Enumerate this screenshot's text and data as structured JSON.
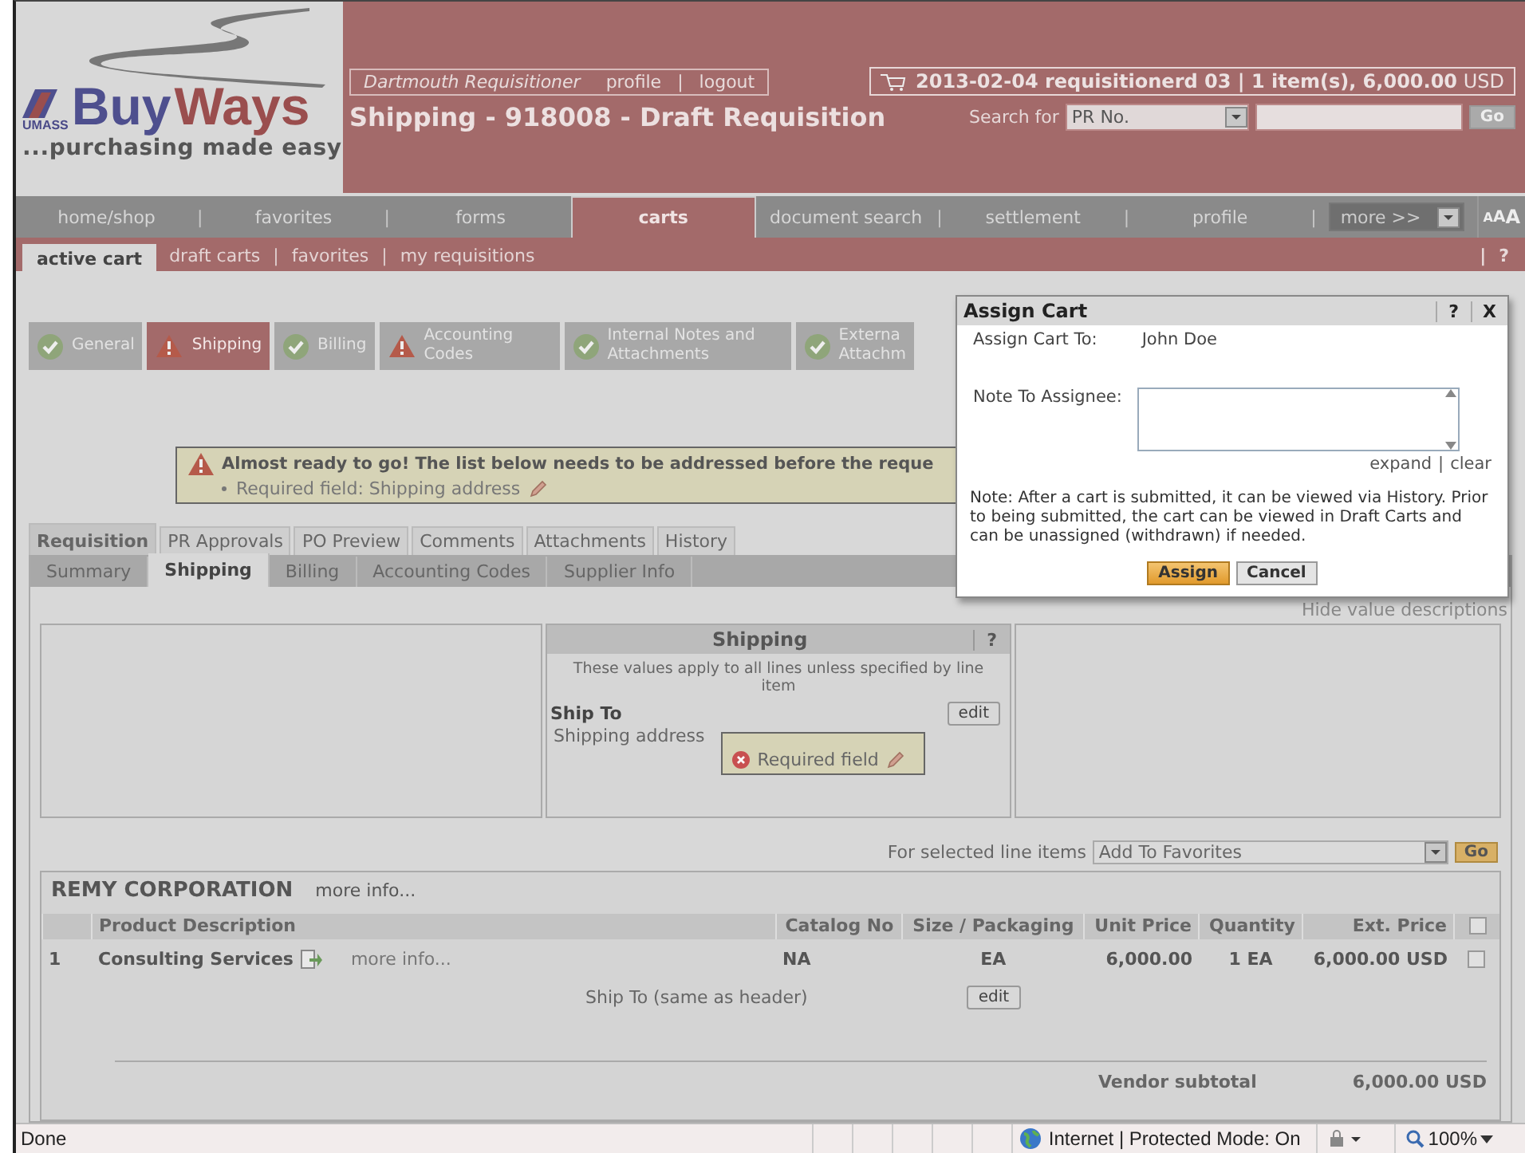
{
  "logo": {
    "word1": "Buy",
    "word2": "Ways",
    "org": "UMASS",
    "tagline": "...purchasing made easy"
  },
  "user_box": {
    "name": "Dartmouth Requisitioner",
    "links": [
      "profile",
      "logout"
    ],
    "separator": "|"
  },
  "page_title": "Shipping - 918008 - Draft Requisition",
  "cart_summary": "**2013-02-04 requisitionerd 03 | 1 item(s), 6,000.00** USD",
  "search": {
    "label": "Search for",
    "type": "PR No.",
    "button": "Go"
  },
  "nav": {
    "separator": "|",
    "items": [
      {
        "label": "home/shop",
        "selected": false
      },
      {
        "label": "favorites",
        "selected": false
      },
      {
        "label": "forms",
        "selected": false
      },
      {
        "label": "carts",
        "selected": true
      },
      {
        "label": "document search",
        "selected": false
      },
      {
        "label": "settlement",
        "selected": false
      },
      {
        "label": "profile",
        "selected": false
      }
    ],
    "more": "more >>",
    "text_size": [
      "A",
      "A",
      "A"
    ]
  },
  "subnav": {
    "separator": "|",
    "help": "?",
    "items": [
      {
        "label": "active cart",
        "selected": true
      },
      {
        "label": "draft carts",
        "selected": false
      },
      {
        "label": "favorites",
        "selected": false
      },
      {
        "label": "my requisitions",
        "selected": false
      }
    ]
  },
  "steps": [
    {
      "label": "General",
      "kind": "ok",
      "selected": false
    },
    {
      "label": "Shipping",
      "kind": "warning",
      "selected": true
    },
    {
      "label": "Billing",
      "kind": "ok",
      "selected": false
    },
    {
      "label": "Accounting Codes",
      "kind": "warning",
      "selected": false
    },
    {
      "label": "Internal Notes and Attachments",
      "kind": "ok",
      "selected": false
    },
    {
      "label": "Externa Attachm",
      "kind": "ok",
      "selected": false
    }
  ],
  "alert": {
    "title": "Almost ready to go! The list below needs to be addressed before the reque",
    "items": [
      "Required field: Shipping address"
    ]
  },
  "tabs": [
    {
      "label": "Requisition",
      "selected": true
    },
    {
      "label": "PR Approvals",
      "selected": false
    },
    {
      "label": "PO Preview",
      "selected": false
    },
    {
      "label": "Comments",
      "selected": false
    },
    {
      "label": "Attachments",
      "selected": false
    },
    {
      "label": "History",
      "selected": false
    }
  ],
  "subtabs": [
    {
      "label": "Summary",
      "selected": false
    },
    {
      "label": "Shipping",
      "selected": true
    },
    {
      "label": "Billing",
      "selected": false
    },
    {
      "label": "Accounting Codes",
      "selected": false
    },
    {
      "label": "Supplier Info",
      "selected": false
    }
  ],
  "hide_descriptions": "Hide value descriptions",
  "shipping_panel": {
    "title": "Shipping",
    "help": "?",
    "description": "These values apply to all lines unless specified by line item",
    "ship_to_label": "Ship To",
    "edit": "edit",
    "field_label": "Shipping address",
    "error": "Required field"
  },
  "line_action": {
    "label": "For selected line items",
    "value": "Add To Favorites",
    "button": "Go"
  },
  "vendor": {
    "name": "REMY CORPORATION",
    "more": "more info...",
    "columns": [
      "Product Description",
      "Catalog No",
      "Size / Packaging",
      "Unit Price",
      "Quantity",
      "Ext. Price"
    ],
    "header_checked": false,
    "rows": [
      {
        "number": "1",
        "description": "Consulting Services",
        "more": "more info...",
        "catalog_no": "NA",
        "size": "EA",
        "unit_price": "6,000.00",
        "quantity": "1 EA",
        "ext_price": "6,000.00 USD",
        "checked": false,
        "ship_to": "Ship To (same as header)",
        "edit": "edit"
      }
    ],
    "subtotal_label": "Vendor subtotal",
    "subtotal": "6,000.00 USD"
  },
  "dialog": {
    "title": "Assign Cart",
    "help": "?",
    "close": "X",
    "assign_label": "Assign Cart To:",
    "assignee": "John Doe",
    "note_label": "Note To Assignee:",
    "expand": "expand",
    "separator": "|",
    "clear": "clear",
    "note": "Note: After a cart is submitted, it can be viewed via History. Prior to being submitted, the cart can be viewed in Draft Carts and can be unassigned (withdrawn) if needed.",
    "buttons": [
      {
        "label": "Assign",
        "kind": "primary"
      },
      {
        "label": "Cancel",
        "kind": "secondary"
      }
    ]
  },
  "status_bar": {
    "text": "Done",
    "zone": "Internet | Protected Mode: On",
    "zoom": "100%"
  }
}
